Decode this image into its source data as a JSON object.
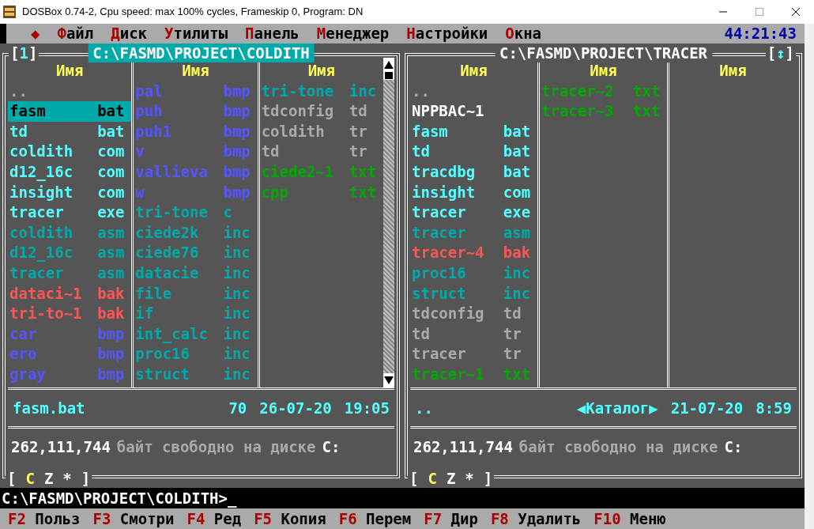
{
  "window": {
    "title": "DOSBox 0.74-2, Cpu speed: max 100% cycles, Frameskip  0, Program:      DN"
  },
  "menu": [
    {
      "hotkey": "◆"
    },
    {
      "hotkey": "Ф",
      "rest": "айл"
    },
    {
      "hotkey": "Д",
      "rest": "иск"
    },
    {
      "hotkey": "У",
      "rest": "тилиты"
    },
    {
      "hotkey": "П",
      "rest": "анель"
    },
    {
      "hotkey": "М",
      "rest": "енеджер"
    },
    {
      "hotkey": "Н",
      "rest": "астройки"
    },
    {
      "hotkey": "О",
      "rest": "кна"
    }
  ],
  "clock": "44:21:43",
  "panels": [
    {
      "active": true,
      "tag": {
        "open": "[",
        "text": "1",
        "close": "]"
      },
      "path": "C:\\FASMD\\PROJECT\\COLDITH",
      "scrollbar": true,
      "columns": [
        {
          "header": "Имя",
          "files": [
            {
              "name": "..",
              "color": "#aaaaaa",
              "selected": false
            },
            {
              "name": "fasm",
              "ext": "bat",
              "selected": true
            },
            {
              "name": "td",
              "ext": "bat",
              "color": "#55ffff",
              "selected": false
            },
            {
              "name": "coldith",
              "ext": "com",
              "color": "#55ffff",
              "selected": false
            },
            {
              "name": "d12_16c",
              "ext": "com",
              "color": "#55ffff",
              "selected": false
            },
            {
              "name": "insight",
              "ext": "com",
              "color": "#55ffff",
              "selected": false
            },
            {
              "name": "tracer",
              "ext": "exe",
              "color": "#55ffff",
              "selected": false
            },
            {
              "name": "coldith",
              "ext": "asm",
              "color": "#00aaaa",
              "selected": false
            },
            {
              "name": "d12_16c",
              "ext": "asm",
              "color": "#00aaaa",
              "selected": false
            },
            {
              "name": "tracer",
              "ext": "asm",
              "color": "#00aaaa",
              "selected": false
            },
            {
              "name": "dataci~1",
              "ext": "bak",
              "color": "#ff5555",
              "selected": false
            },
            {
              "name": "tri-to~1",
              "ext": "bak",
              "color": "#ff5555",
              "selected": false
            },
            {
              "name": "car",
              "ext": "bmp",
              "color": "#5555ff",
              "selected": false
            },
            {
              "name": "ero",
              "ext": "bmp",
              "color": "#5555ff",
              "selected": false
            },
            {
              "name": "gray",
              "ext": "bmp",
              "color": "#5555ff",
              "selected": false
            }
          ]
        },
        {
          "header": "Имя",
          "files": [
            {
              "name": "pal",
              "ext": "bmp",
              "color": "#5555ff",
              "selected": false
            },
            {
              "name": "puh",
              "ext": "bmp",
              "color": "#5555ff",
              "selected": false
            },
            {
              "name": "puh1",
              "ext": "bmp",
              "color": "#5555ff",
              "selected": false
            },
            {
              "name": "v",
              "ext": "bmp",
              "color": "#5555ff",
              "selected": false
            },
            {
              "name": "vallieva",
              "ext": "bmp",
              "color": "#5555ff",
              "selected": false
            },
            {
              "name": "w",
              "ext": "bmp",
              "color": "#5555ff",
              "selected": false
            },
            {
              "name": "tri-tone",
              "ext": "c",
              "color": "#00aaaa",
              "selected": false
            },
            {
              "name": "ciede2k",
              "ext": "inc",
              "color": "#00aaaa",
              "selected": false
            },
            {
              "name": "ciede76",
              "ext": "inc",
              "color": "#00aaaa",
              "selected": false
            },
            {
              "name": "datacie",
              "ext": "inc",
              "color": "#00aaaa",
              "selected": false
            },
            {
              "name": "file",
              "ext": "inc",
              "color": "#00aaaa",
              "selected": false
            },
            {
              "name": "if",
              "ext": "inc",
              "color": "#00aaaa",
              "selected": false
            },
            {
              "name": "int_calc",
              "ext": "inc",
              "color": "#00aaaa",
              "selected": false
            },
            {
              "name": "proc16",
              "ext": "inc",
              "color": "#00aaaa",
              "selected": false
            },
            {
              "name": "struct",
              "ext": "inc",
              "color": "#00aaaa",
              "selected": false
            }
          ]
        },
        {
          "header": "Имя",
          "files": [
            {
              "name": "tri-tone",
              "ext": "inc",
              "color": "#00aaaa",
              "selected": false
            },
            {
              "name": "tdconfig",
              "ext": "td",
              "color": "#aaaaaa",
              "selected": false
            },
            {
              "name": "coldith",
              "ext": "tr",
              "color": "#aaaaaa",
              "selected": false
            },
            {
              "name": "td",
              "ext": "tr",
              "color": "#aaaaaa",
              "selected": false
            },
            {
              "name": "ciede2~1",
              "ext": "txt",
              "color": "#00aa00",
              "selected": false
            },
            {
              "name": "cpp",
              "ext": "txt",
              "color": "#00aa00",
              "selected": false
            }
          ]
        }
      ],
      "info": {
        "name": "fasm.bat",
        "size": "70",
        "date": "26-07-20",
        "time": "19:05"
      },
      "free": {
        "amount": "262,111,744",
        "text": "байт свободно на диске",
        "drive": "C:"
      },
      "drive_bar": {
        "open": "[",
        "close": "]",
        "drives": [
          {
            "letter": "C",
            "selected": true
          },
          {
            "letter": "Z",
            "selected": false
          },
          {
            "letter": "*",
            "selected": false
          }
        ]
      }
    },
    {
      "active": false,
      "tag": {
        "open": "[",
        "text": "↕",
        "close": "]"
      },
      "path": "C:\\FASMD\\PROJECT\\TRACER",
      "scrollbar": false,
      "columns": [
        {
          "header": "Имя",
          "files": [
            {
              "name": "..",
              "color": "#aaaaaa",
              "selected": false
            },
            {
              "name": "NPPBAC~1",
              "color": "#ffffff",
              "selected": false
            },
            {
              "name": "fasm",
              "ext": "bat",
              "color": "#55ffff",
              "selected": false
            },
            {
              "name": "td",
              "ext": "bat",
              "color": "#55ffff",
              "selected": false
            },
            {
              "name": "tracdbg",
              "ext": "bat",
              "color": "#55ffff",
              "selected": false
            },
            {
              "name": "insight",
              "ext": "com",
              "color": "#55ffff",
              "selected": false
            },
            {
              "name": "tracer",
              "ext": "exe",
              "color": "#55ffff",
              "selected": false
            },
            {
              "name": "tracer",
              "ext": "asm",
              "color": "#00aaaa",
              "selected": false
            },
            {
              "name": "tracer~4",
              "ext": "bak",
              "color": "#ff5555",
              "selected": false
            },
            {
              "name": "proc16",
              "ext": "inc",
              "color": "#00aaaa",
              "selected": false
            },
            {
              "name": "struct",
              "ext": "inc",
              "color": "#00aaaa",
              "selected": false
            },
            {
              "name": "tdconfig",
              "ext": "td",
              "color": "#aaaaaa",
              "selected": false
            },
            {
              "name": "td",
              "ext": "tr",
              "color": "#aaaaaa",
              "selected": false
            },
            {
              "name": "tracer",
              "ext": "tr",
              "color": "#aaaaaa",
              "selected": false
            },
            {
              "name": "tracer~1",
              "ext": "txt",
              "color": "#00aa00",
              "selected": false
            }
          ]
        },
        {
          "header": "Имя",
          "files": [
            {
              "name": "tracer~2",
              "ext": "txt",
              "color": "#00aa00",
              "selected": false
            },
            {
              "name": "tracer~3",
              "ext": "txt",
              "color": "#00aa00",
              "selected": false
            }
          ]
        },
        {
          "header": "Имя"
        }
      ],
      "info": {
        "name": "..",
        "size": "◀Каталог▶",
        "date": "21-07-20",
        "time": "8:59"
      },
      "free": {
        "amount": "262,111,744",
        "text": "байт свободно на диске",
        "drive": "C:"
      },
      "drive_bar": {
        "open": "[",
        "close": "]",
        "drives": [
          {
            "letter": "C",
            "selected": true
          },
          {
            "letter": "Z",
            "selected": false
          },
          {
            "letter": "*",
            "selected": false
          }
        ]
      }
    }
  ],
  "command_line": {
    "prompt": "C:\\FASMD\\PROJECT\\COLDITH>",
    "cursor": "_"
  },
  "fkeys": [
    {
      "key": "F2",
      "label": "Польз"
    },
    {
      "key": "F3",
      "label": "Смотри"
    },
    {
      "key": "F4",
      "label": "Ред"
    },
    {
      "key": "F5",
      "label": "Копия"
    },
    {
      "key": "F6",
      "label": "Перем"
    },
    {
      "key": "F7",
      "label": "Дир"
    },
    {
      "key": "F8",
      "label": "Удалить"
    },
    {
      "key": "F10",
      "label": "Меню"
    }
  ]
}
